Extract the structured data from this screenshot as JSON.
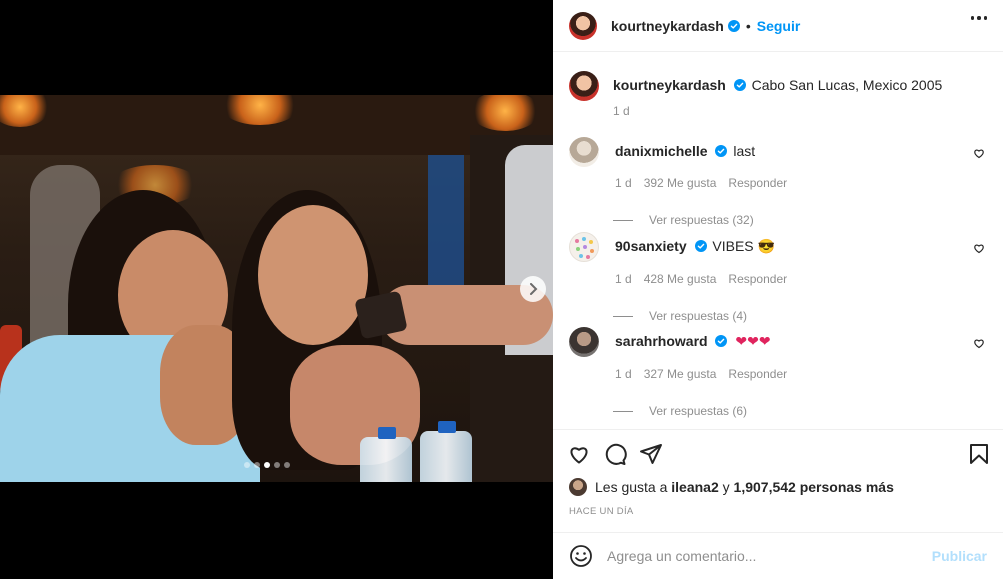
{
  "post": {
    "author": "kourtneykardash",
    "follow_label": "Seguir",
    "separator": "•",
    "caption_text": "Cabo San Lucas, Mexico 2005",
    "caption_time": "1 d",
    "carousel": {
      "total_slides": 5,
      "active_slide": 3
    }
  },
  "comments": [
    {
      "username": "danixmichelle",
      "text": "last",
      "time": "1 d",
      "likes": "392 Me gusta",
      "reply_label": "Responder",
      "replies_label": "Ver respuestas (32)"
    },
    {
      "username": "90sanxiety",
      "text": "VIBES",
      "emoji": "😎",
      "time": "1 d",
      "likes": "428 Me gusta",
      "reply_label": "Responder",
      "replies_label": "Ver respuestas (4)"
    },
    {
      "username": "sarahrhoward",
      "text": "",
      "emoji": "❤❤❤",
      "time": "1 d",
      "likes": "327 Me gusta",
      "reply_label": "Responder",
      "replies_label": "Ver respuestas (6)"
    }
  ],
  "likes": {
    "prefix": "Les gusta a",
    "user": "ileana2",
    "conjunction": "y",
    "count": "1,907,542 personas más"
  },
  "timestamp": "HACE UN DÍA",
  "composer": {
    "placeholder": "Agrega un comentario...",
    "post_label": "Publicar"
  },
  "colors": {
    "accent": "#0095f6",
    "text": "#262626",
    "muted": "#8e8e8e",
    "publish_disabled": "#b2dffc",
    "heart_red": "#e0245e"
  },
  "icons": [
    "verified-icon",
    "more-options-icon",
    "heart-icon",
    "comment-icon",
    "share-icon",
    "bookmark-icon",
    "emoji-icon",
    "chevron-right-icon"
  ]
}
